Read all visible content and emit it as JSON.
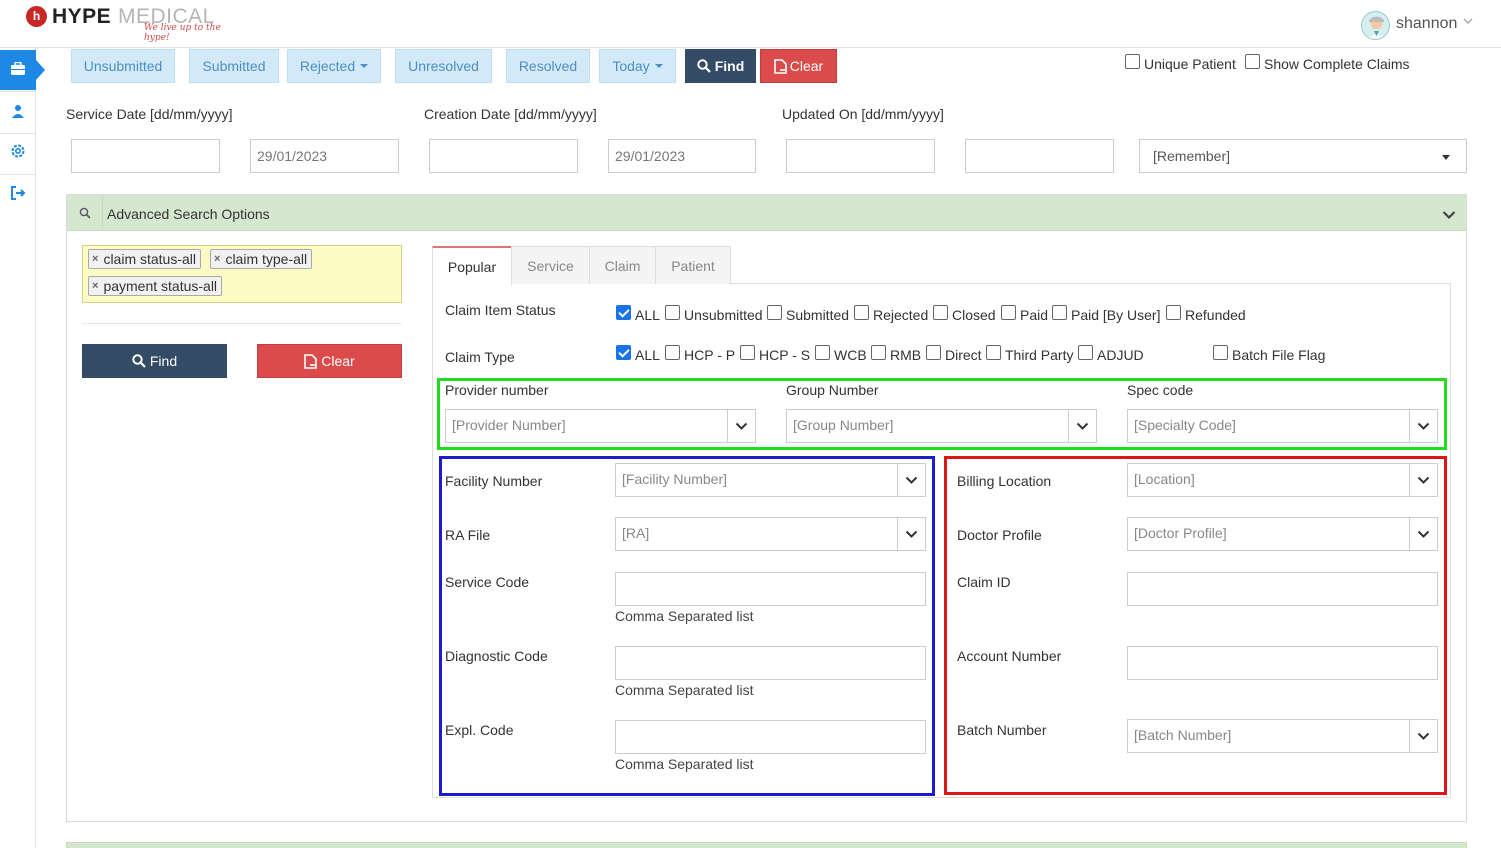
{
  "header": {
    "logo_letter": "h",
    "logo_hype": "HYPE",
    "logo_medical": "MEDICAL",
    "logo_tagline": "We live up to the hype!",
    "user_name": "shannon"
  },
  "sidebar": {
    "items": [
      {
        "icon": "briefcase-icon",
        "active": true
      },
      {
        "icon": "user-doctor-icon",
        "active": false
      },
      {
        "icon": "gear-icon",
        "active": false
      },
      {
        "icon": "sign-out-icon",
        "active": false
      }
    ]
  },
  "status_filters": {
    "unsubmitted": "Unsubmitted",
    "submitted": "Submitted",
    "rejected": "Rejected",
    "unresolved": "Unresolved",
    "resolved": "Resolved",
    "today": "Today",
    "find": "Find",
    "clear": "Clear"
  },
  "options": {
    "unique_patient": "Unique Patient",
    "show_complete_claims": "Show Complete Claims"
  },
  "date_filters": {
    "service_date_label": "Service Date [dd/mm/yyyy]",
    "creation_date_label": "Creation Date [dd/mm/yyyy]",
    "updated_on_label": "Updated On [dd/mm/yyyy]",
    "service_from": "",
    "service_to": "29/01/2023",
    "creation_from": "",
    "creation_to": "29/01/2023",
    "updated_from": "",
    "updated_to": "",
    "remember": "[Remember]"
  },
  "advanced": {
    "title": "Advanced Search Options",
    "tags": [
      "claim status-all",
      "claim type-all",
      "payment status-all"
    ],
    "find": "Find",
    "clear": "Clear",
    "tabs": [
      "Popular",
      "Service",
      "Claim",
      "Patient"
    ],
    "active_tab": "Popular",
    "claim_item_status": {
      "label": "Claim Item Status",
      "options": [
        {
          "label": "ALL",
          "checked": true
        },
        {
          "label": "Unsubmitted",
          "checked": false
        },
        {
          "label": "Submitted",
          "checked": false
        },
        {
          "label": "Rejected",
          "checked": false
        },
        {
          "label": "Closed",
          "checked": false
        },
        {
          "label": "Paid",
          "checked": false
        },
        {
          "label": "Paid [By User]",
          "checked": false
        },
        {
          "label": "Refunded",
          "checked": false
        }
      ]
    },
    "claim_type": {
      "label": "Claim Type",
      "options": [
        {
          "label": "ALL",
          "checked": true
        },
        {
          "label": "HCP - P",
          "checked": false
        },
        {
          "label": "HCP - S",
          "checked": false
        },
        {
          "label": "WCB",
          "checked": false
        },
        {
          "label": "RMB",
          "checked": false
        },
        {
          "label": "Direct",
          "checked": false
        },
        {
          "label": "Third Party",
          "checked": false
        },
        {
          "label": "ADJUD",
          "checked": false
        }
      ],
      "batch_file_flag": "Batch File Flag"
    },
    "provider_number": {
      "label": "Provider number",
      "placeholder": "[Provider Number]"
    },
    "group_number": {
      "label": "Group Number",
      "placeholder": "[Group Number]"
    },
    "spec_code": {
      "label": "Spec code",
      "placeholder": "[Specialty Code]"
    },
    "facility_number": {
      "label": "Facility Number",
      "placeholder": "[Facility Number]"
    },
    "ra_file": {
      "label": "RA File",
      "placeholder": "[RA]"
    },
    "service_code": {
      "label": "Service Code",
      "hint": "Comma Separated list"
    },
    "diagnostic_code": {
      "label": "Diagnostic Code",
      "hint": "Comma Separated list"
    },
    "expl_code": {
      "label": "Expl. Code",
      "hint": "Comma Separated list"
    },
    "billing_location": {
      "label": "Billing Location",
      "placeholder": "[Location]"
    },
    "doctor_profile": {
      "label": "Doctor Profile",
      "placeholder": "[Doctor Profile]"
    },
    "claim_id": {
      "label": "Claim ID"
    },
    "account_number": {
      "label": "Account Number"
    },
    "batch_number": {
      "label": "Batch Number",
      "placeholder": "[Batch Number]"
    }
  },
  "colors": {
    "frame_green": "#1fdc1f",
    "frame_blue": "#1c1ccc",
    "frame_red": "#e01515",
    "find_button": "#344b66",
    "clear_button": "#dc4b4b"
  }
}
